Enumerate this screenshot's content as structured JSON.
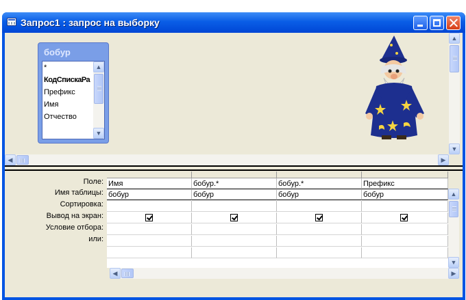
{
  "window": {
    "title": "Запрос1 : запрос на выборку",
    "colors": {
      "titlebar": "#0a5ee6",
      "client": "#ece9d8",
      "table_header": "#7a9ee7"
    }
  },
  "table": {
    "name": "бобур",
    "fields": [
      "*",
      "КодСпискаРа",
      "Префикс",
      "Имя",
      "Отчество"
    ]
  },
  "grid": {
    "row_labels": [
      "Поле:",
      "Имя таблицы:",
      "Сортировка:",
      "Вывод на экран:",
      "Условие отбора:",
      "или:"
    ],
    "columns": [
      {
        "field": "Имя",
        "table": "бобур",
        "sort": "",
        "show": true
      },
      {
        "field": "бобур.*",
        "table": "бобур",
        "sort": "",
        "show": true
      },
      {
        "field": "бобур.*",
        "table": "бобур",
        "sort": "",
        "show": true
      },
      {
        "field": "Префикс",
        "table": "бобур",
        "sort": "",
        "show": true
      }
    ]
  },
  "icons": {
    "window": "query-window-icon",
    "assistant": "office-assistant-wizard",
    "scroll_up": "arrow-up-icon",
    "scroll_down": "arrow-down-icon",
    "scroll_left": "arrow-left-icon",
    "scroll_right": "arrow-right-icon"
  }
}
